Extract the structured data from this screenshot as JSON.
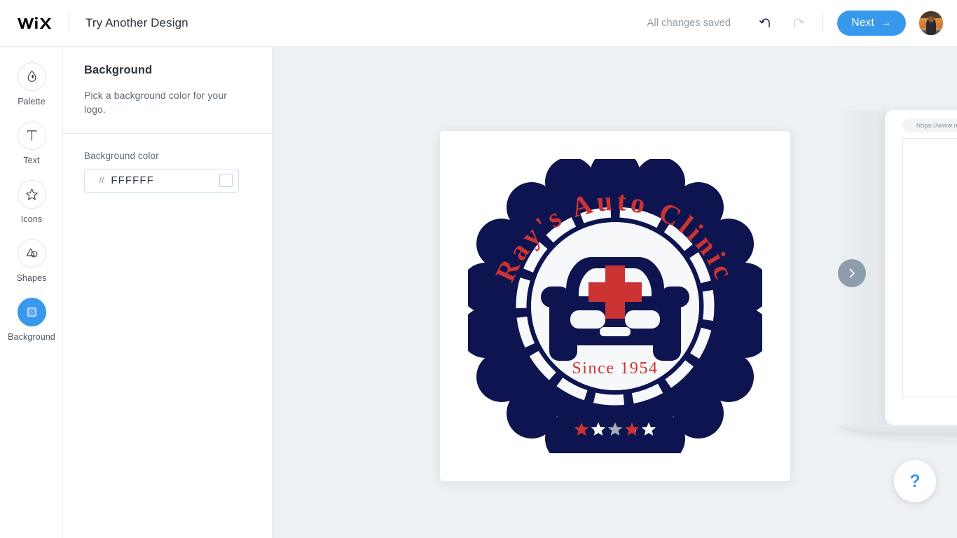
{
  "topbar": {
    "brand": "WiX",
    "title": "Try Another Design",
    "save_status": "All changes saved",
    "undo_label": "Undo",
    "redo_label": "Redo",
    "next_label": "Next",
    "next_arrow": "→",
    "avatar_label": "Account avatar"
  },
  "rail": {
    "items": [
      {
        "label": "Palette",
        "icon": "droplet-icon",
        "active": false
      },
      {
        "label": "Text",
        "icon": "text-t-icon",
        "active": false
      },
      {
        "label": "Icons",
        "icon": "star-outline-icon",
        "active": false
      },
      {
        "label": "Shapes",
        "icon": "shapes-icon",
        "active": false
      },
      {
        "label": "Background",
        "icon": "background-hatch-icon",
        "active": true
      }
    ]
  },
  "panel": {
    "title": "Background",
    "subtitle": "Pick a background color for your logo.",
    "field_label": "Background color",
    "hash": "#",
    "hex_value": "FFFFFF",
    "hex_placeholder": "FFFFFF",
    "swatch_color": "#FFFFFF"
  },
  "logo": {
    "title_text": "Ray's Auto Clinic",
    "title_chars": [
      "R",
      "a",
      "y",
      "'",
      "s",
      " ",
      "A",
      "u",
      "t",
      "o",
      " ",
      "C",
      "l",
      "i",
      "n",
      "i",
      "c"
    ],
    "tagline": "Since 1954",
    "stars": [
      "#CC3333",
      "#FFFFFF",
      "#A8AEB4",
      "#CC3333",
      "#FFFFFF"
    ],
    "navy": "#0D1450",
    "red": "#CC3333",
    "white": "#F7F8FA",
    "canvas_background": "#FFFFFF",
    "symbol": "car-front-with-medical-cross"
  },
  "preview": {
    "url": "https://www.m",
    "next_arrow_glyph": "›",
    "device": "laptop-browser-mockup"
  },
  "help": {
    "glyph": "?",
    "label": "Help"
  },
  "stage": {
    "background": "#EEF1F4"
  }
}
